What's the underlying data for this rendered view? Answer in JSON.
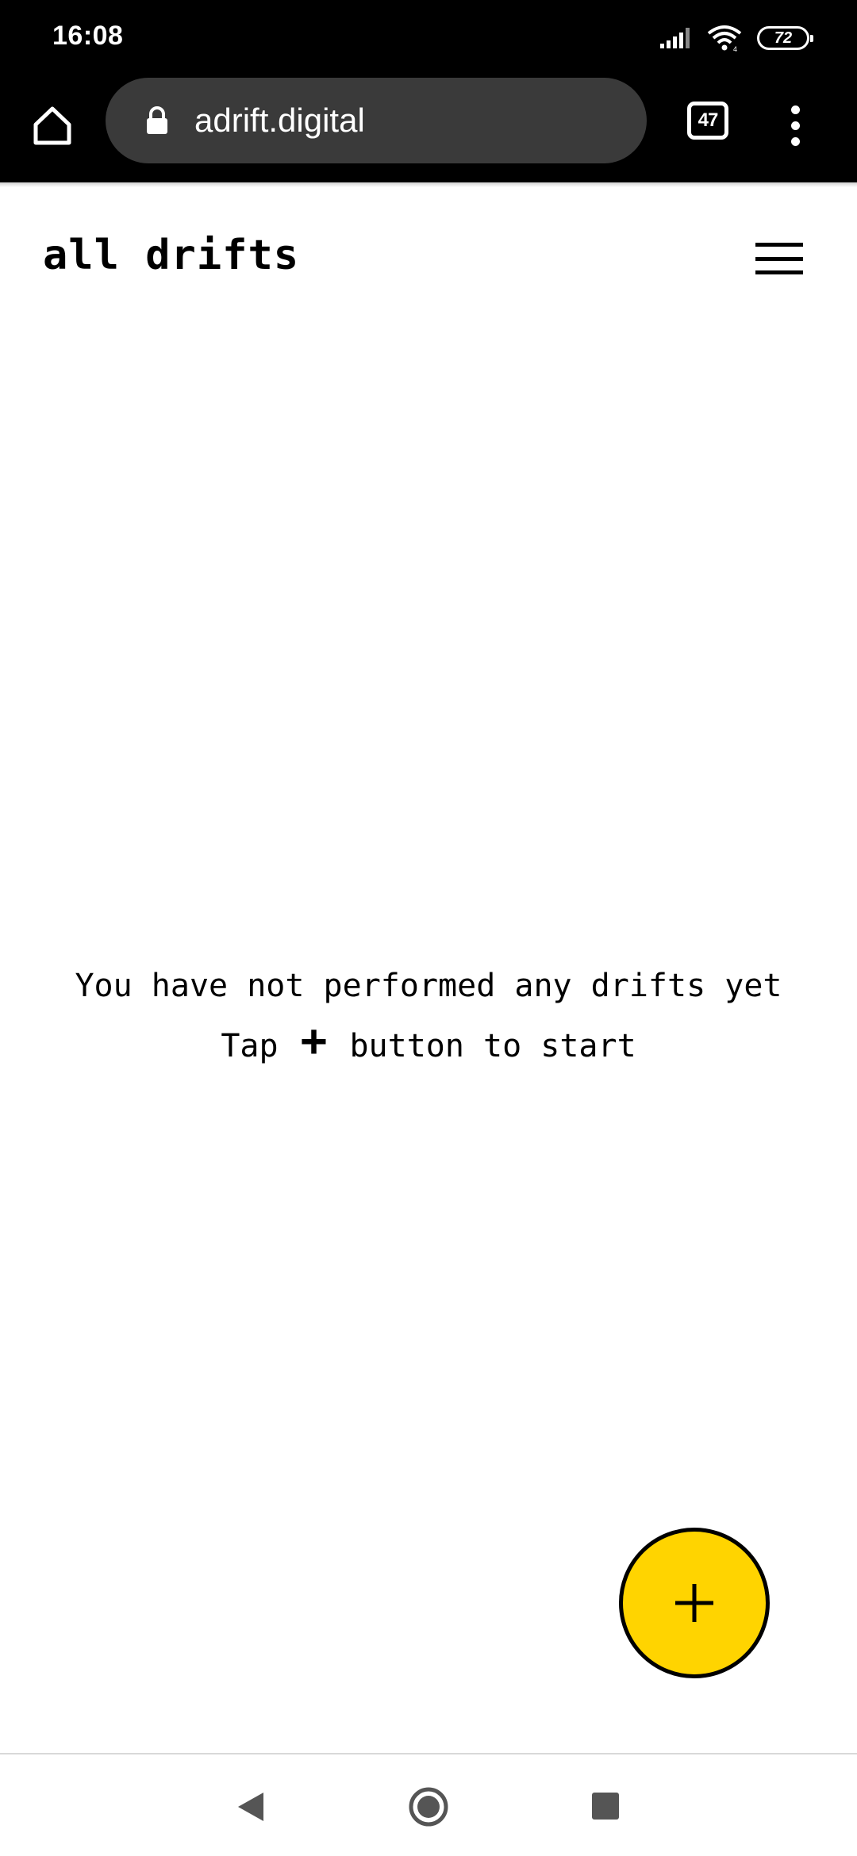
{
  "status_bar": {
    "time": "16:08",
    "battery": "72"
  },
  "browser": {
    "url": "adrift.digital",
    "tab_count": "47"
  },
  "page": {
    "title": "all drifts",
    "empty_line_1": "You have not performed any drifts yet",
    "empty_line_2_before": "Tap ",
    "empty_line_2_plus": "+",
    "empty_line_2_after": " button to start"
  },
  "fab": {
    "icon": "plus-icon",
    "color": "#ffd400"
  },
  "nav": {
    "icons": [
      "back-icon",
      "home-icon",
      "recents-icon"
    ]
  }
}
